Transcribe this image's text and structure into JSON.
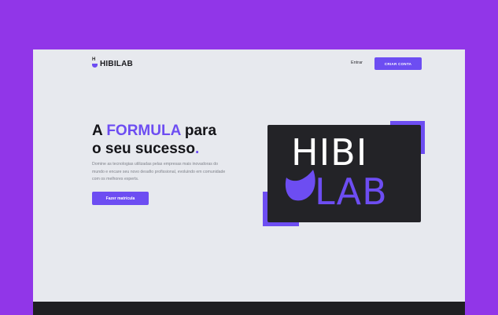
{
  "header": {
    "logo_text": "HIBILAB",
    "logo_mark_letter": "H",
    "login_label": "Entrar",
    "cta_label": "CRIAR CONTA"
  },
  "hero": {
    "title_word_1": "A",
    "title_accent": "FORMULA",
    "title_word_2": "para",
    "title_line_2": "o seu sucesso",
    "title_dot": ".",
    "description": "Domine as tecnologias utilizadas pelas empresas mais inovadoras do mundo e encare seu novo desafio profissional, evoluindo em comunidade com os melhores experts.",
    "button_label": "Fazer matrícula"
  },
  "brand_card": {
    "line_1": "HIBI",
    "line_2": "LAB"
  },
  "colors": {
    "background": "#9136e8",
    "accent": "#6d4df2",
    "page": "#e7e9ee",
    "card": "#232327"
  }
}
